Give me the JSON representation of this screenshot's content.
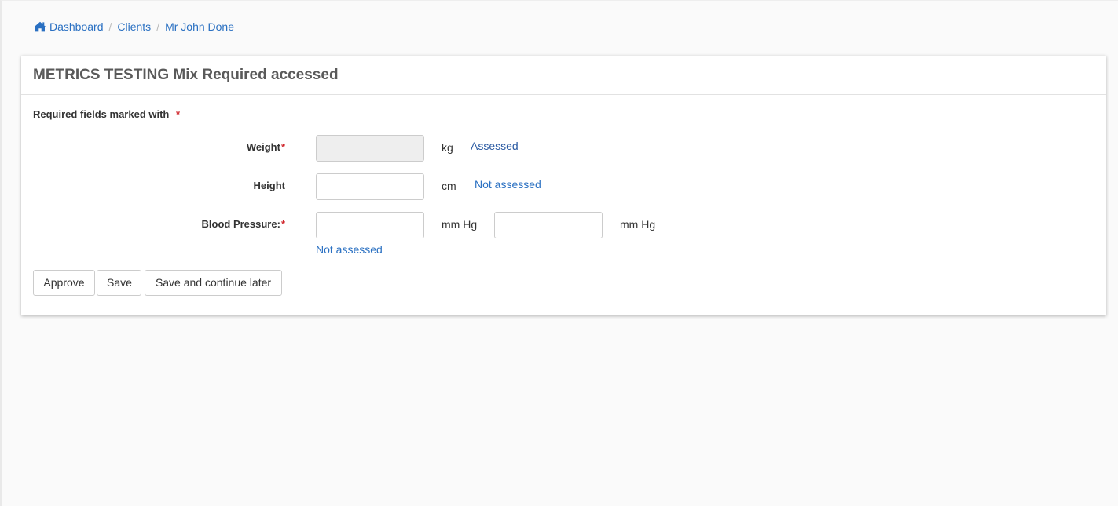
{
  "breadcrumb": {
    "items": [
      {
        "label": "Dashboard",
        "icon": "home-icon"
      },
      {
        "label": "Clients"
      },
      {
        "label": "Mr John Done"
      }
    ],
    "separator": "/"
  },
  "panel": {
    "title": "METRICS TESTING Mix Required accessed",
    "required_note": "Required fields marked with",
    "required_marker": "*"
  },
  "fields": {
    "weight": {
      "label": "Weight",
      "required_marker": "*",
      "value": "",
      "unit": "kg",
      "status": "Assessed",
      "disabled": true
    },
    "height": {
      "label": "Height",
      "value": "",
      "unit": "cm",
      "status": "Not assessed"
    },
    "blood_pressure": {
      "label": "Blood Pressure:",
      "required_marker": "*",
      "value1": "",
      "unit1": "mm Hg",
      "value2": "",
      "unit2": "mm Hg",
      "status": "Not assessed"
    }
  },
  "buttons": {
    "approve": "Approve",
    "save": "Save",
    "save_later": "Save and continue later"
  },
  "colors": {
    "link": "#2a70c2",
    "required": "#d0262c",
    "title": "#5a5a5a"
  }
}
